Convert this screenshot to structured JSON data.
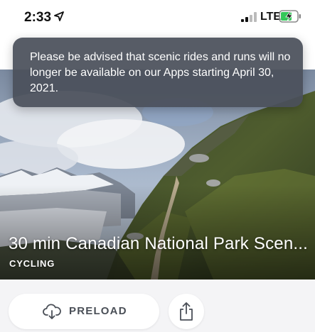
{
  "status_bar": {
    "time": "2:33",
    "network": "LTE",
    "icons": [
      "location-arrow-icon",
      "cellular-signal-icon",
      "battery-charging-icon"
    ]
  },
  "toast": {
    "message": "Please be advised that scenic rides and runs will no longer be available on our Apps starting April 30, 2021."
  },
  "workout": {
    "title": "30 min Canadian National Park Scen...",
    "category": "CYCLING"
  },
  "actions": {
    "preload_label": "PRELOAD",
    "preload_icon": "cloud-download-icon",
    "share_icon": "share-icon"
  },
  "colors": {
    "toast_bg": "#4a505a",
    "battery_green": "#34c759",
    "button_text": "#4a4f57",
    "page_bg": "#f4f4f6"
  }
}
